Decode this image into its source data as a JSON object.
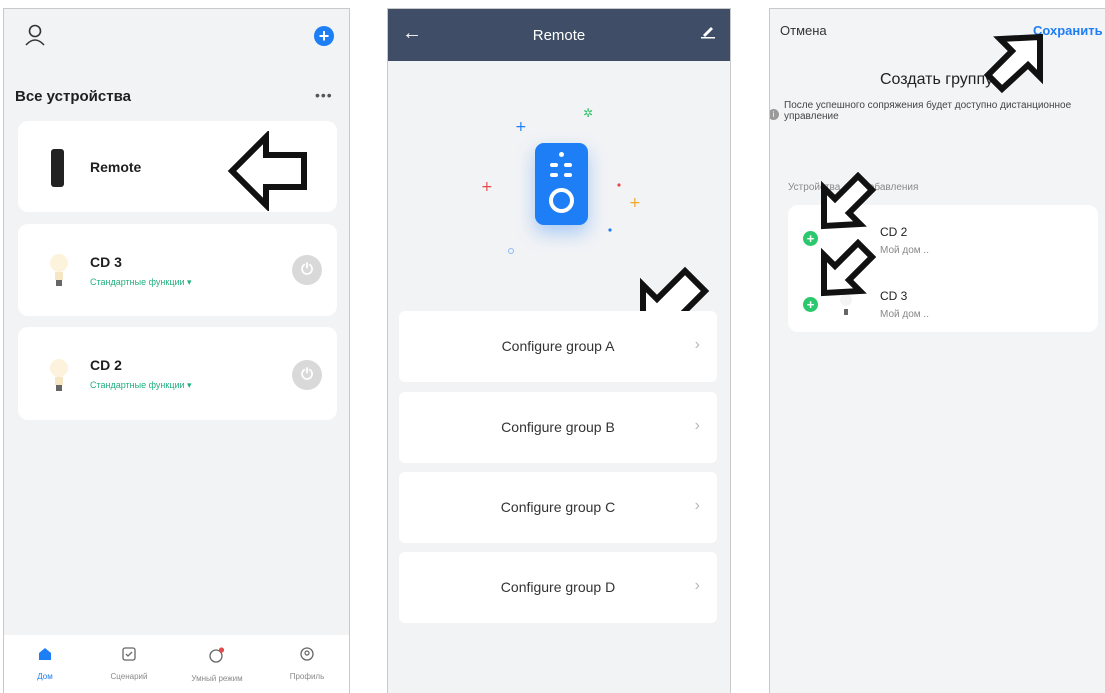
{
  "devices_screen": {
    "title": "Все устройства",
    "devices": [
      {
        "name": "Remote"
      },
      {
        "name": "CD 3",
        "subtitle": "Стандартные функции ▾"
      },
      {
        "name": "CD 2",
        "subtitle": "Стандартные функции ▾"
      }
    ],
    "tabs": [
      "Дом",
      "Сценарий",
      "Умный режим",
      "Профиль"
    ]
  },
  "remote_screen": {
    "title": "Remote",
    "groups": [
      "Configure group A",
      "Configure group B",
      "Configure group C",
      "Configure group D"
    ]
  },
  "create_group_screen": {
    "cancel": "Отмена",
    "save": "Сохранить",
    "title": "Создать группу",
    "info": "После успешного сопряжения будет доступно дистанционное управление",
    "section": "Устройства для добавления",
    "devices": [
      {
        "name": "CD 2",
        "location": "Мой дом .."
      },
      {
        "name": "CD 3",
        "location": "Мой дом .."
      }
    ]
  },
  "colors": {
    "accent": "#1e7ef5",
    "header": "#3f4d66",
    "success": "#2cc86d",
    "link_green": "#22b07d"
  }
}
